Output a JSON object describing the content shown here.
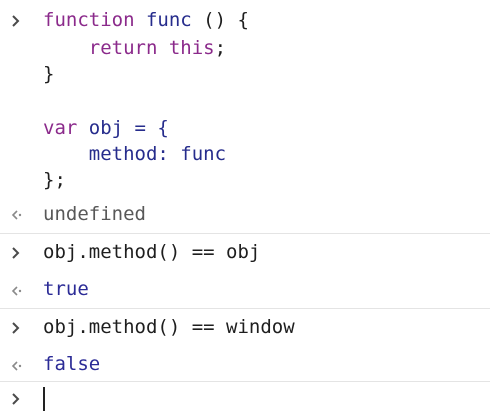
{
  "input_block": {
    "line1": {
      "kw": "function",
      "name": " func ",
      "rest": "() {"
    },
    "line2": {
      "indent": "    ",
      "kw": "return this",
      "rest": ";"
    },
    "line3": {
      "text": "}"
    },
    "line5": {
      "kw": "var",
      "rest": " obj = {"
    },
    "line6": {
      "text": "    method: func"
    },
    "line7": {
      "text": "};"
    }
  },
  "output1": "undefined",
  "input2": "obj.method() == obj",
  "output2": "true",
  "input3": "obj.method() == window",
  "output3": "false"
}
